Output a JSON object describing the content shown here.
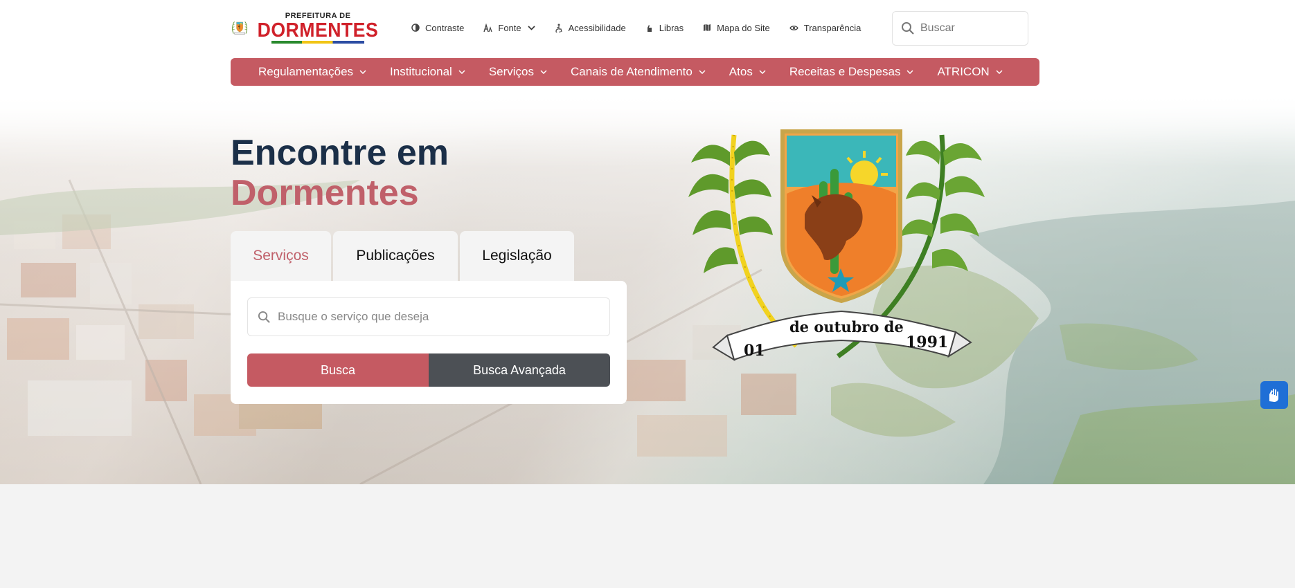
{
  "header": {
    "logo": {
      "small_text": "PREFEITURA DE",
      "big_text": "DORMENTES"
    },
    "utility_links": [
      {
        "label": "Contraste",
        "icon": "contrast-icon"
      },
      {
        "label": "Fonte",
        "icon": "font-size-icon"
      },
      {
        "label": "Acessibilidade",
        "icon": "accessibility-icon"
      },
      {
        "label": "Libras",
        "icon": "sign-language-icon"
      },
      {
        "label": "Mapa do Site",
        "icon": "map-icon"
      },
      {
        "label": "Transparência",
        "icon": "eye-icon"
      }
    ],
    "search": {
      "placeholder": "Buscar"
    }
  },
  "nav": {
    "items": [
      {
        "label": "Regulamentações"
      },
      {
        "label": "Institucional"
      },
      {
        "label": "Serviços"
      },
      {
        "label": "Canais de Atendimento"
      },
      {
        "label": "Atos"
      },
      {
        "label": "Receitas e Despesas"
      },
      {
        "label": "ATRICON"
      }
    ]
  },
  "hero": {
    "title_line1": "Encontre em",
    "title_line2": "Dormentes",
    "tabs": [
      {
        "label": "Serviços",
        "active": true
      },
      {
        "label": "Publicações",
        "active": false
      },
      {
        "label": "Legislação",
        "active": false
      }
    ],
    "search": {
      "placeholder": "Busque o serviço que deseja",
      "search_button": "Busca",
      "advanced_button": "Busca Avançada"
    },
    "crest": {
      "day": "01",
      "ribbon": "de outubro de",
      "year": "1991"
    }
  },
  "colors": {
    "brand": "#c55a62",
    "title_dark": "#1b2f48",
    "advanced_button": "#4c5055",
    "vlibras": "#1f6fd6"
  }
}
